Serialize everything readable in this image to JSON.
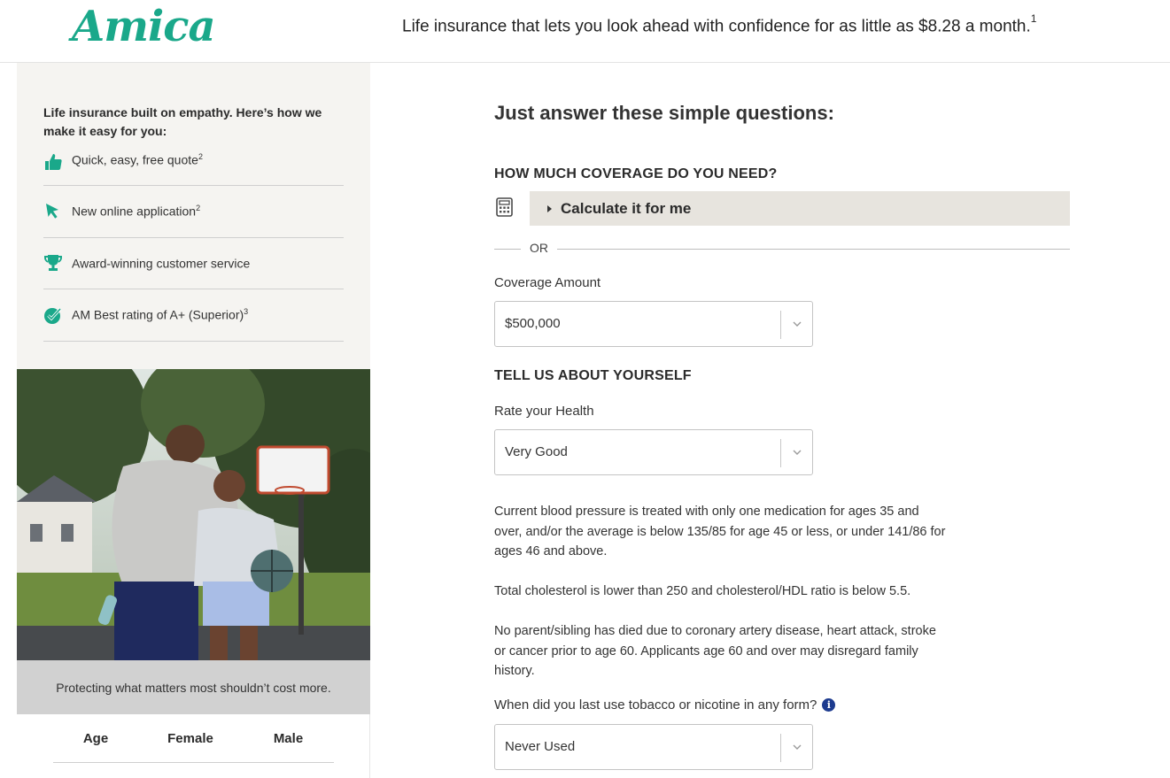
{
  "header": {
    "logo": "Amica",
    "tagline": "Life insurance that lets you look ahead with confidence for as little as $8.28 a month.",
    "tagline_footnote": "1"
  },
  "sidebar": {
    "intro": "Life insurance built on empathy. Here’s how we make it easy for you:",
    "benefits": [
      {
        "label": "Quick, easy, free quote",
        "footnote": "2",
        "icon": "thumbs-up-icon"
      },
      {
        "label": "New online application",
        "footnote": "2",
        "icon": "cursor-arrow-icon"
      },
      {
        "label": "Award-winning customer service",
        "footnote": "",
        "icon": "trophy-icon"
      },
      {
        "label": "AM Best rating of A+ (Superior)",
        "footnote": "3",
        "icon": "checkmark-circle-icon"
      }
    ],
    "caption": "Protecting what matters most shouldn’t cost more.",
    "rate_table": {
      "headers": [
        "Age",
        "Female",
        "Male"
      ]
    }
  },
  "main": {
    "title": "Just answer these simple questions:",
    "coverage_section": "HOW MUCH COVERAGE DO YOU NEED?",
    "calculate_label": "Calculate it for me",
    "or_label": "OR",
    "coverage_amount": {
      "label": "Coverage Amount",
      "value": "$500,000"
    },
    "about_section": "TELL US ABOUT YOURSELF",
    "health": {
      "label": "Rate your Health",
      "value": "Very Good"
    },
    "health_notes": [
      "Current blood pressure is treated with only one medication for ages 35 and over, and/or the average is below 135/85 for age 45 or less, or under 141/86 for ages 46 and above.",
      "Total cholesterol is lower than 250 and cholesterol/HDL ratio is below 5.5.",
      "No parent/sibling has died due to coronary artery disease, heart attack, stroke or cancer prior to age 60. Applicants age 60 and over may disregard family history."
    ],
    "tobacco": {
      "label": "When did you last use tobacco or nicotine in any form?",
      "value": "Never Used"
    }
  },
  "colors": {
    "brand": "#1aa88a",
    "panel": "#f5f4f1",
    "calc_button": "#e7e4de",
    "info_icon": "#1d3b8f"
  }
}
